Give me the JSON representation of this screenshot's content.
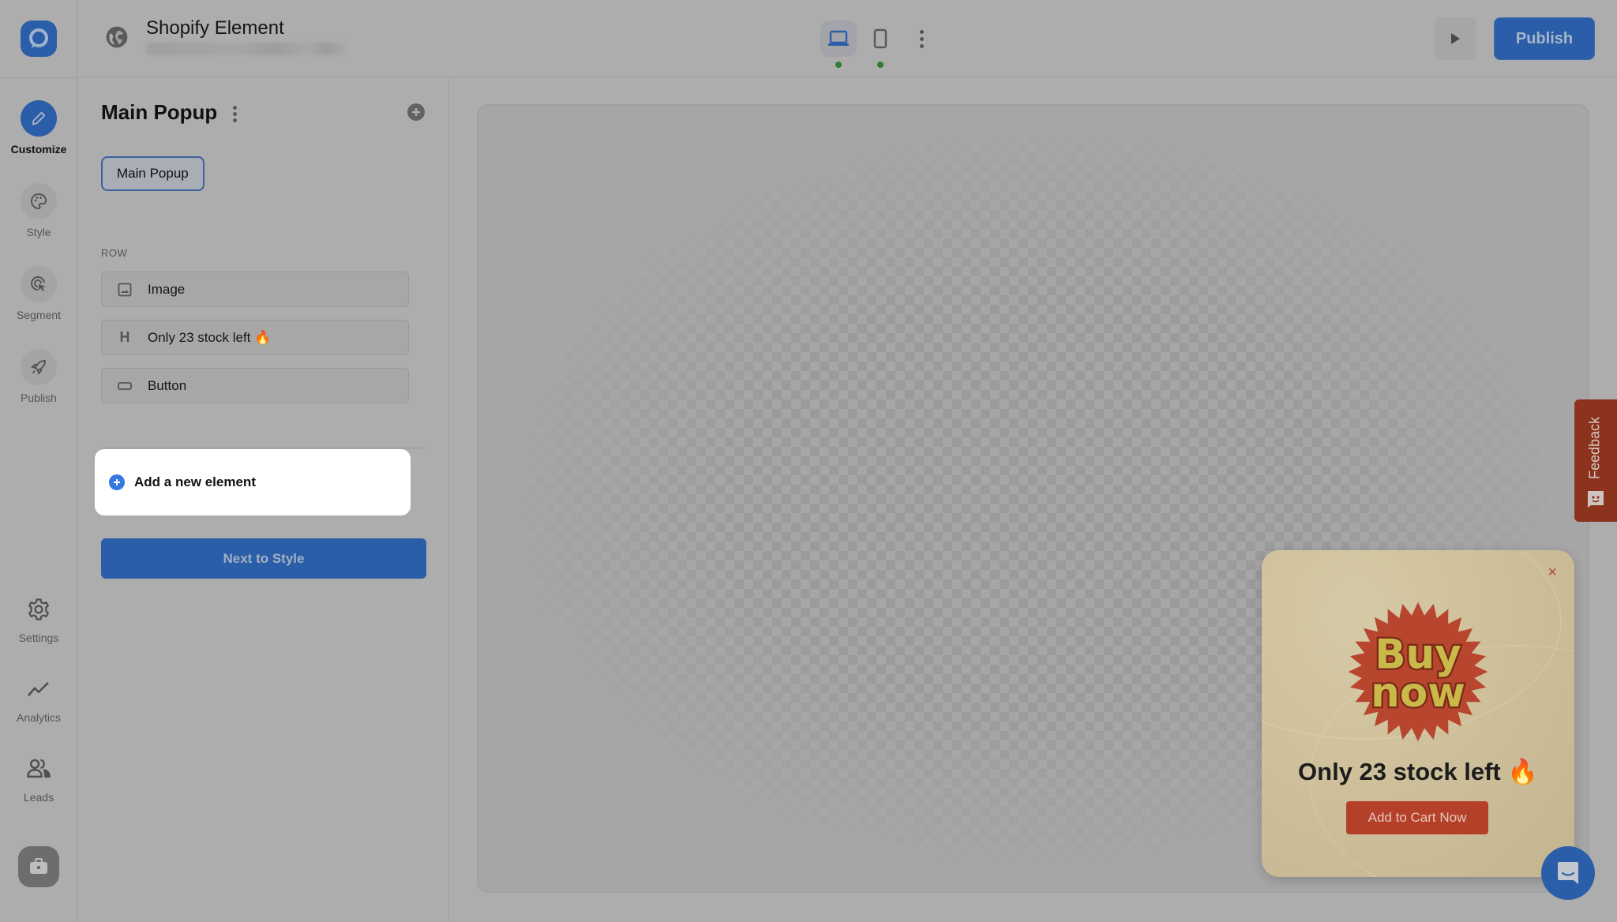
{
  "app": {
    "title": "Shopify Element",
    "subtitle_blurred": true
  },
  "colors": {
    "brand_blue": "#2a5ea8",
    "accent_blue": "#3478e0",
    "status_green": "#2e7d32",
    "popup_red": "#b5402a",
    "feedback_red": "#8c331e"
  },
  "rail": {
    "items": [
      {
        "id": "customize",
        "label": "Customize",
        "icon": "pencil-icon",
        "active": true
      },
      {
        "id": "style",
        "label": "Style",
        "icon": "palette-icon",
        "active": false
      },
      {
        "id": "segment",
        "label": "Segment",
        "icon": "target-cursor-icon",
        "active": false
      },
      {
        "id": "publish",
        "label": "Publish",
        "icon": "rocket-icon",
        "active": false
      }
    ],
    "bottom_items": [
      {
        "id": "settings",
        "label": "Settings",
        "icon": "gear-icon"
      },
      {
        "id": "analytics",
        "label": "Analytics",
        "icon": "trend-line-icon"
      },
      {
        "id": "leads",
        "label": "Leads",
        "icon": "users-icon"
      }
    ],
    "briefcase_icon": "briefcase-icon"
  },
  "topbar": {
    "devices": [
      {
        "id": "desktop",
        "icon": "laptop-icon",
        "active": true,
        "status": "green"
      },
      {
        "id": "mobile",
        "icon": "phone-icon",
        "active": false,
        "status": "green"
      }
    ],
    "preview_icon": "play-icon",
    "publish_label": "Publish"
  },
  "panel": {
    "title": "Main Popup",
    "chip_label": "Main Popup",
    "section_label": "ROW",
    "elements": [
      {
        "type": "image",
        "icon": "image-icon",
        "label": "Image"
      },
      {
        "type": "heading",
        "icon": "heading-icon",
        "icon_glyph": "H",
        "label": "Only 23 stock left 🔥"
      },
      {
        "type": "button",
        "icon": "button-icon",
        "label": "Button"
      }
    ],
    "add_element_label": "Add a new element",
    "next_label": "Next to Style"
  },
  "popup": {
    "image_text_line1": "Buy",
    "image_text_line2": "now",
    "heading": "Only 23 stock left 🔥",
    "cta_label": "Add to Cart Now",
    "close_glyph": "×"
  },
  "feedback": {
    "label": "Feedback"
  }
}
